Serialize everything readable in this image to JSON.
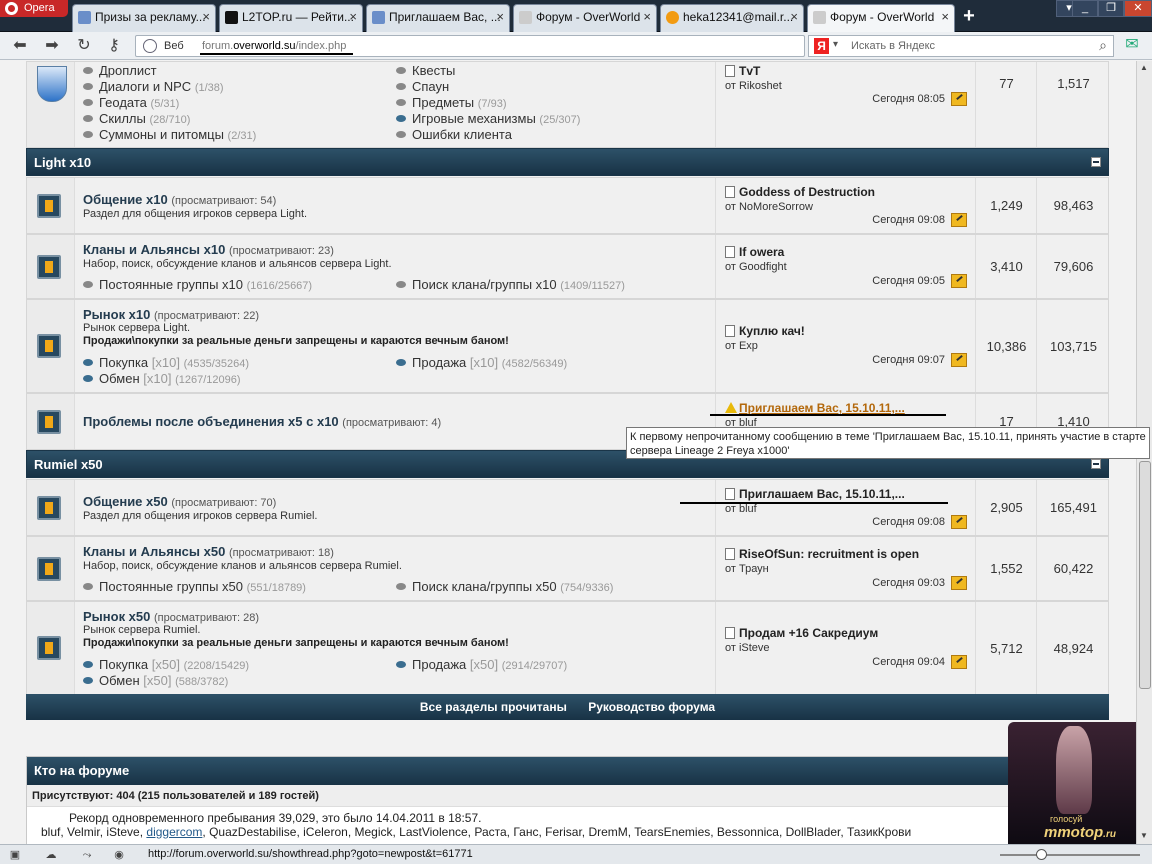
{
  "browser": {
    "opera_label": "Opera",
    "tabs": [
      {
        "label": "Призы за рекламу..."
      },
      {
        "label": "L2TOP.ru — Рейти..."
      },
      {
        "label": "Приглашаем Вас, ..."
      },
      {
        "label": "Форум - OverWorld"
      },
      {
        "label": "heka12341@mail.r..."
      },
      {
        "label": "Форум - OverWorld"
      }
    ],
    "web_label": "Веб",
    "url_prefix": "forum.",
    "url_domain": "overworld.su",
    "url_path": "/index.php",
    "search_placeholder": "Искать в Яндекс",
    "yandex_logo": "Я",
    "status_url": "http://forum.overworld.su/showthread.php?goto=newpost&t=61771"
  },
  "top_block": {
    "subforums_left": [
      {
        "label": "Дроплист",
        "count": ""
      },
      {
        "label": "Диалоги и NPC",
        "count": "(1/38)"
      },
      {
        "label": "Геодата",
        "count": "(5/31)"
      },
      {
        "label": "Скиллы",
        "count": "(28/710)"
      },
      {
        "label": "Суммоны и питомцы",
        "count": "(2/31)"
      }
    ],
    "subforums_right": [
      {
        "label": "Квесты",
        "count": ""
      },
      {
        "label": "Спаун",
        "count": ""
      },
      {
        "label": "Предметы",
        "count": "(7/93)"
      },
      {
        "label": "Игровые механизмы",
        "count": "(25/307)"
      },
      {
        "label": "Ошибки клиента",
        "count": ""
      }
    ],
    "last_title": "TvT",
    "last_author": "от Rikoshet",
    "last_date": "Сегодня 08:05",
    "threads": "77",
    "posts": "1,517"
  },
  "categories": {
    "light": "Light x10",
    "rumiel": "Rumiel x50"
  },
  "forums": [
    {
      "title": "Общение x10",
      "viewers": "(просматривают: 54)",
      "desc": "Раздел для общения игроков сервера Light.",
      "last_title": "Goddess of Destruction",
      "last_author": "от NoMoreSorrow",
      "last_date": "Сегодня 09:08",
      "threads": "1,249",
      "posts": "98,463"
    },
    {
      "title": "Кланы и Альянсы x10",
      "viewers": "(просматривают: 23)",
      "desc": "Набор, поиск, обсуждение кланов и альянсов сервера Light.",
      "sub1": "Постоянные группы x10",
      "sub1_cnt": "(1616/25667)",
      "sub2": "Поиск клана/группы x10",
      "sub2_cnt": "(1409/11527)",
      "last_title": "If owera",
      "last_author": "от Goodfight",
      "last_date": "Сегодня 09:05",
      "threads": "3,410",
      "posts": "79,606"
    },
    {
      "title": "Рынок x10",
      "viewers": "(просматривают: 22)",
      "desc": "Рынок сервера Light.",
      "rule": "Продажи\\покупки за реальные деньги запрещены и караются вечным баном!",
      "sub1": "Покупка",
      "sub1_tag": "[x10]",
      "sub1_cnt": "(4535/35264)",
      "sub2": "Продажа",
      "sub2_tag": "[x10]",
      "sub2_cnt": "(4582/56349)",
      "sub3": "Обмен",
      "sub3_tag": "[x10]",
      "sub3_cnt": "(1267/12096)",
      "last_title": "Куплю кач!",
      "last_author": "от Exp",
      "last_date": "Сегодня 09:07",
      "threads": "10,386",
      "posts": "103,715"
    },
    {
      "title": "Проблемы после объединения x5 с x10",
      "viewers": "(просматривают: 4)",
      "last_title": "Приглашаем Вас, 15.10.11,...",
      "last_author": "от bluf",
      "threads": "17",
      "posts": "1,410"
    },
    {
      "title": "Общение x50",
      "viewers": "(просматривают: 70)",
      "desc": "Раздел для общения игроков сервера Rumiel.",
      "last_title": "Приглашаем Вас, 15.10.11,...",
      "last_author": "от bluf",
      "last_date": "Сегодня 09:08",
      "threads": "2,905",
      "posts": "165,491"
    },
    {
      "title": "Кланы и Альянсы x50",
      "viewers": "(просматривают: 18)",
      "desc": "Набор, поиск, обсуждение кланов и альянсов сервера Rumiel.",
      "sub1": "Постоянные группы x50",
      "sub1_cnt": "(551/18789)",
      "sub2": "Поиск клана/группы x50",
      "sub2_cnt": "(754/9336)",
      "last_title": "RiseOfSun: recruitment is open",
      "last_author": "от Траун",
      "last_date": "Сегодня 09:03",
      "threads": "1,552",
      "posts": "60,422"
    },
    {
      "title": "Рынок x50",
      "viewers": "(просматривают: 28)",
      "desc": "Рынок сервера Rumiel.",
      "rule": "Продажи\\покупки за реальные деньги запрещены и караются вечным баном!",
      "sub1": "Покупка",
      "sub1_tag": "[x50]",
      "sub1_cnt": "(2208/15429)",
      "sub2": "Продажа",
      "sub2_tag": "[x50]",
      "sub2_cnt": "(2914/29707)",
      "sub3": "Обмен",
      "sub3_tag": "[x50]",
      "sub3_cnt": "(588/3782)",
      "last_title": "Продам +16 Сакредиум",
      "last_author": "от iSteve",
      "last_date": "Сегодня 09:04",
      "threads": "5,712",
      "posts": "48,924"
    }
  ],
  "tooltip": "К первому непрочитанному сообщению в теме 'Приглашаем Вас, 15.10.11, принять участие в старте сервера Lineage 2 Freya x1000'",
  "footer": {
    "mark_read": "Все разделы прочитаны",
    "guide": "Руководство форума"
  },
  "online": {
    "title": "Кто на форуме",
    "present": "Присутствуют: 404 (215 пользователей и 189 гостей)",
    "record": "Рекорд одновременного пребывания 39,029, это было 14.04.2011 в 18:57.",
    "users_a": "bluf, Velmir, iSteve, ",
    "users_link": "diggercom",
    "users_b": ", QuazDestabilise, iCeleron, Megick, LastViolence, Раста, Ганс, Ferisar, DremM, TearsEnemies, Bessonnica, DollBlader, ТазикКрови"
  },
  "banner": {
    "golos": "голосуй",
    "brand": "mmotop",
    "tld": ".ru"
  }
}
